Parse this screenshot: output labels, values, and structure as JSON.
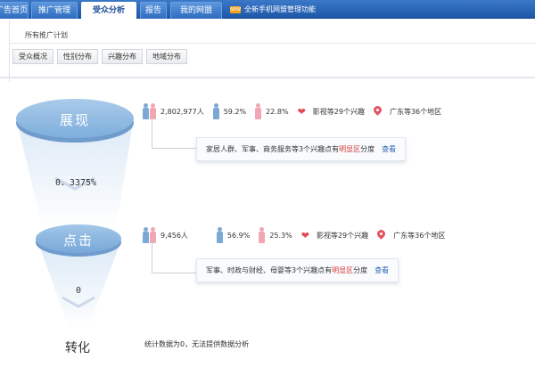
{
  "nav": {
    "tabs": [
      {
        "label": "广告首页"
      },
      {
        "label": "推广管理"
      },
      {
        "label": "受众分析"
      },
      {
        "label": "报告"
      },
      {
        "label": "我的网盟"
      }
    ],
    "active_tab": "受众分析",
    "promo_text": "全新手机网盟管理功能"
  },
  "breadcrumb": "所有推广计划",
  "sub_tabs": [
    "受众概况",
    "性别分布",
    "兴趣分布",
    "地域分布"
  ],
  "funnel": {
    "stage1_label": "展现",
    "rate1": "0．3375%",
    "stage2_label": "点击",
    "rate2": "0",
    "stage3_label": "转化"
  },
  "row1": {
    "people": "2,802,977人",
    "male_pct": "59.2%",
    "female_pct": "22.8%",
    "interest": "影视等29个兴趣",
    "region": "广东等36个地区",
    "hint_prefix": "家居人群、军事、商务服务等3个兴趣点有",
    "hint_highlight": "明显区",
    "hint_suffix": "分度",
    "view": "查看"
  },
  "row2": {
    "people": "9,456人",
    "male_pct": "56.9%",
    "female_pct": "25.3%",
    "interest": "影视等29个兴趣",
    "region": "广东等36个地区",
    "hint_prefix": "军事、时政与财经、母婴等3个兴趣点有",
    "hint_highlight": "明显区",
    "hint_suffix": "分度",
    "view": "查看"
  },
  "conversion_note": "统计数据为0，无法提供数据分析",
  "colors": {
    "nav_blue": "#1d58a8",
    "male_blue": "#7aa9d6",
    "female_pink": "#f1a7b3",
    "highlight_red": "#d63a3a",
    "funnel_blue": "#8fb9e0"
  }
}
